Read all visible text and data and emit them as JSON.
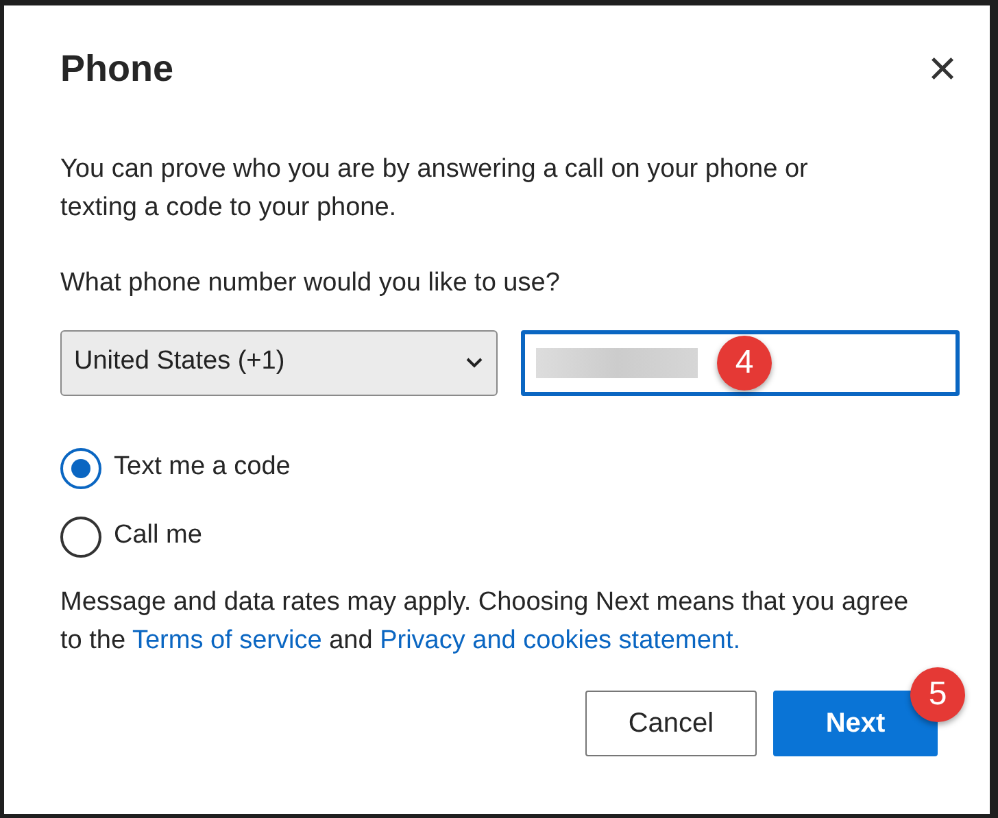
{
  "dialog": {
    "title": "Phone",
    "close": "×"
  },
  "intro": "You can prove who you are by answering a call on your phone or texting a code to your phone.",
  "question": "What phone number would you like to use?",
  "country": {
    "value": "United States (+1)"
  },
  "phone_field": {
    "redacted": true,
    "badge": "4"
  },
  "options": [
    {
      "label": "Text me a code",
      "selected": true
    },
    {
      "label": "Call me",
      "selected": false
    }
  ],
  "disclaimer": {
    "text": "Message and data rates may apply. Choosing Next means that you agree to the",
    "joiner": "and",
    "links": [
      "Terms of service",
      "Privacy and cookies statement."
    ]
  },
  "buttons": [
    {
      "label": "Cancel",
      "kind": "secondary"
    },
    {
      "label": "Next",
      "kind": "primary",
      "badge": "5"
    }
  ]
}
